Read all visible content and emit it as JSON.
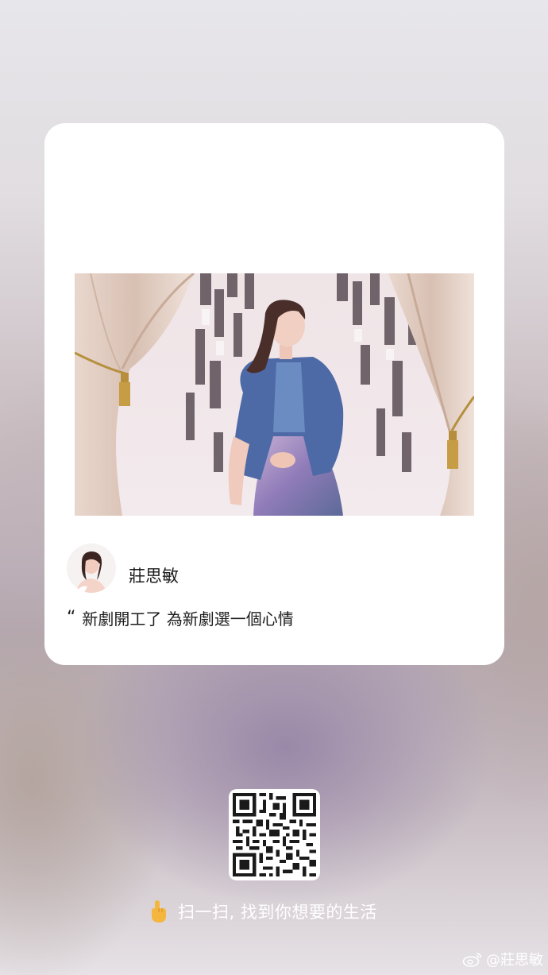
{
  "card": {
    "author_name": "莊思敏",
    "quote_mark": "“",
    "quote_text": "新劇開工了 為新劇選一個心情"
  },
  "share": {
    "scan_text": "扫一扫, 找到你想要的生活",
    "hand_icon": "pointing-hand-icon"
  },
  "watermark": {
    "text": "@莊思敏",
    "icon": "weibo-logo-icon"
  },
  "colors": {
    "card_background": "#ffffff",
    "text_primary": "#1c1c1c",
    "overlay_text": "#ffffff"
  }
}
